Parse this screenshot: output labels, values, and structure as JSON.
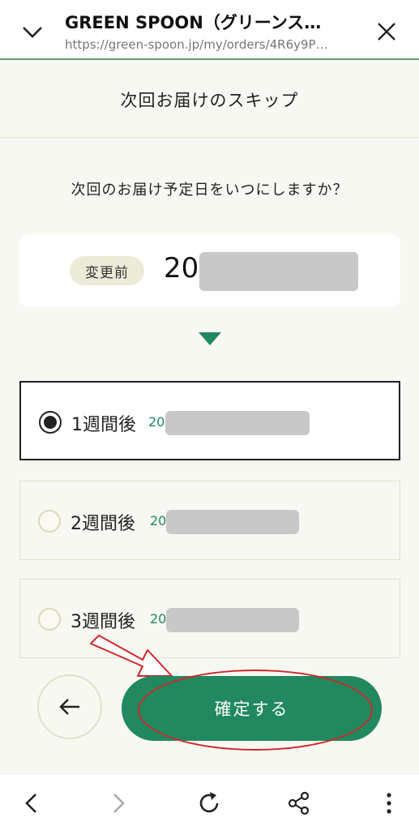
{
  "browser": {
    "title": "GREEN SPOON（グリーンス…",
    "url": "https://green-spoon.jp/my/orders/4R6y9P…"
  },
  "page": {
    "heading": "次回お届けのスキップ",
    "question": "次回のお届け予定日をいつにしますか？"
  },
  "current": {
    "badge": "変更前",
    "date_prefix": "20"
  },
  "options": [
    {
      "label": "1週間後",
      "date_prefix": "20",
      "selected": true
    },
    {
      "label": "2週間後",
      "date_prefix": "20",
      "selected": false
    },
    {
      "label": "3週間後",
      "date_prefix": "20",
      "selected": false
    }
  ],
  "actions": {
    "confirm_label": "確定する"
  },
  "colors": {
    "accent": "#21885f",
    "annotation": "#d0282a",
    "background": "#f8f8f2"
  },
  "icons": {
    "collapse": "chevron-down-icon",
    "close": "close-icon",
    "back": "arrow-left-icon",
    "nav_back": "chevron-left-icon",
    "nav_forward": "chevron-right-icon",
    "reload": "reload-icon",
    "share": "share-icon",
    "menu": "more-vert-icon"
  }
}
